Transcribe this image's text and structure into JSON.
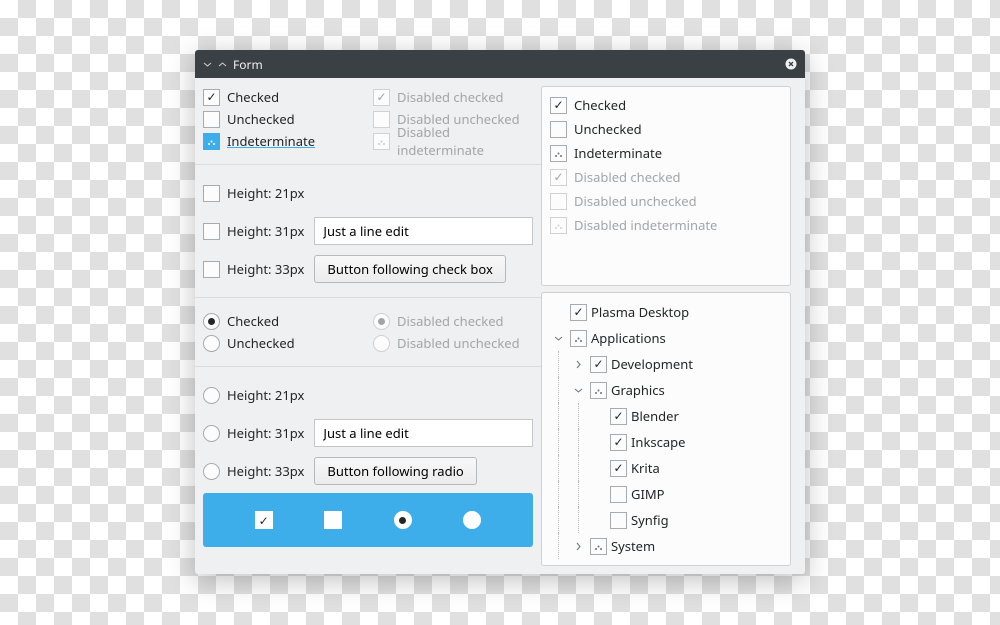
{
  "window": {
    "title": "Form"
  },
  "col1": {
    "ck_checked": "Checked",
    "ck_unchecked": "Unchecked",
    "ck_indeterminate": "Indeterminate",
    "ck_dis_checked": "Disabled checked",
    "ck_dis_unchecked": "Disabled unchecked",
    "ck_dis_indeterminate": "Disabled indeterminate",
    "h21": "Height: 21px",
    "h31": "Height: 31px",
    "h33": "Height: 33px",
    "lineedit1": "Just a line edit",
    "btn1": "Button following check box",
    "rd_checked": "Checked",
    "rd_unchecked": "Unchecked",
    "rd_dis_checked": "Disabled checked",
    "rd_dis_unchecked": "Disabled unchecked",
    "lineedit2": "Just a line edit",
    "btn2": "Button following radio"
  },
  "col2": {
    "ck_checked": "Checked",
    "ck_unchecked": "Unchecked",
    "ck_indeterminate": "Indeterminate",
    "ck_dis_checked": "Disabled checked",
    "ck_dis_unchecked": "Disabled unchecked",
    "ck_dis_indeterminate": "Disabled indeterminate",
    "tree": {
      "plasma": "Plasma Desktop",
      "apps": "Applications",
      "dev": "Development",
      "gfx": "Graphics",
      "blender": "Blender",
      "inkscape": "Inkscape",
      "krita": "Krita",
      "gimp": "GIMP",
      "synfig": "Synfig",
      "system": "System"
    }
  }
}
